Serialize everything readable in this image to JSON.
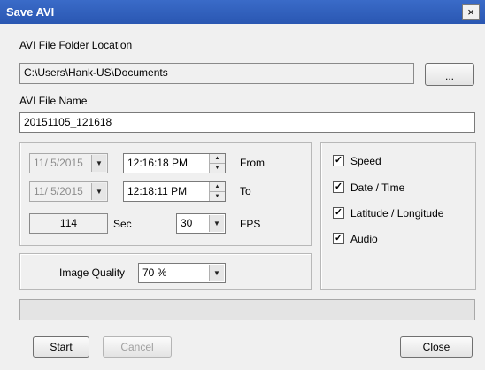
{
  "window": {
    "title": "Save AVI",
    "close_glyph": "×"
  },
  "folder": {
    "label": "AVI File Folder Location",
    "value": "C:\\Users\\Hank-US\\Documents",
    "browse_label": "..."
  },
  "file": {
    "label": "AVI File Name",
    "value": "20151105_121618"
  },
  "range": {
    "from": {
      "date": "11/ 5/2015",
      "time": "12:16:18 PM",
      "label": "From"
    },
    "to": {
      "date": "11/ 5/2015",
      "time": "12:18:11 PM",
      "label": "To"
    },
    "duration": {
      "value": "114",
      "unit": "Sec"
    },
    "fps": {
      "value": "30",
      "unit": "FPS"
    }
  },
  "quality": {
    "label": "Image Quality",
    "value": "70 %"
  },
  "overlays": [
    {
      "label": "Speed",
      "checked": true
    },
    {
      "label": "Date / Time",
      "checked": true
    },
    {
      "label": "Latitude / Longitude",
      "checked": true
    },
    {
      "label": "Audio",
      "checked": true
    }
  ],
  "progress": {
    "fraction": 0
  },
  "buttons": {
    "start": "Start",
    "cancel": "Cancel",
    "close": "Close"
  },
  "icons": {
    "dropdown": "chevron-down-icon",
    "spin_up": "spin-up-icon",
    "spin_down": "spin-down-icon",
    "check": "checkmark-icon"
  },
  "colors": {
    "titlebar": "#2f5fbf",
    "dialog_bg": "#f0f0f0"
  }
}
